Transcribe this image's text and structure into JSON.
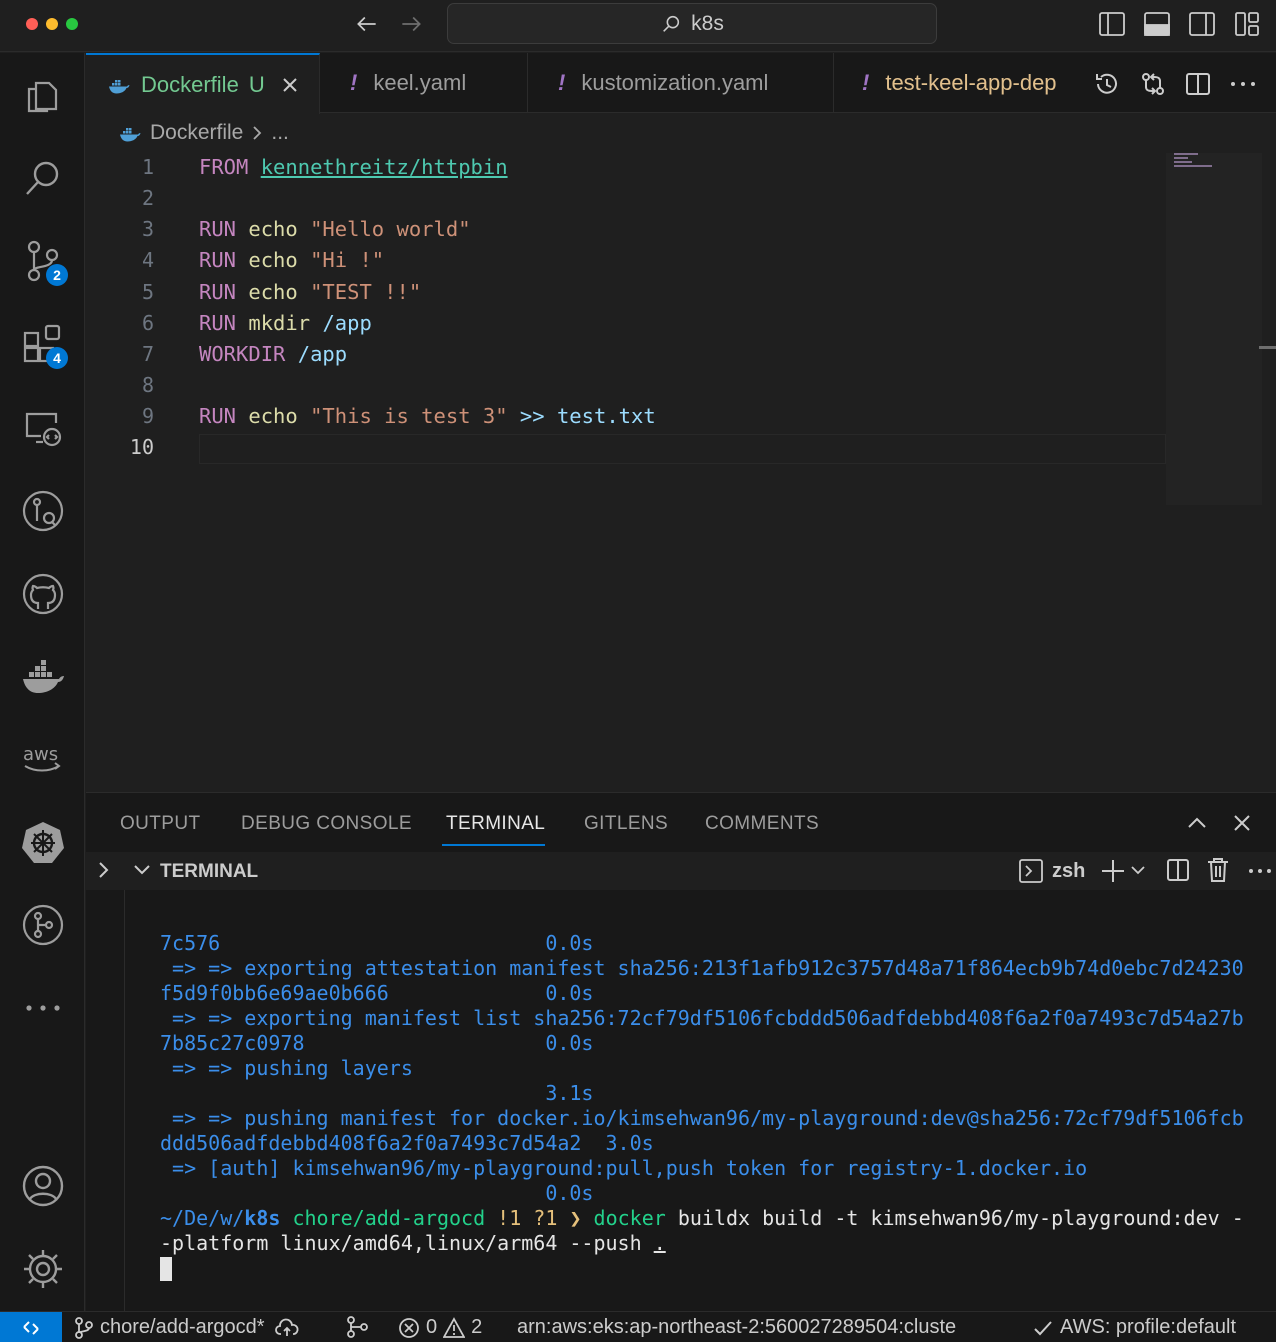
{
  "titlebar": {
    "search_text": "k8s"
  },
  "activity": {
    "scm_badge": "2",
    "extensions_badge": "4"
  },
  "tabs": [
    {
      "label": "Dockerfile",
      "status": "U"
    },
    {
      "label": "keel.yaml"
    },
    {
      "label": "kustomization.yaml"
    },
    {
      "label": "test-keel-app-dep"
    }
  ],
  "yaml_marker": "!",
  "breadcrumb": {
    "file": "Dockerfile",
    "more": "..."
  },
  "editor": {
    "line_numbers": [
      "1",
      "2",
      "3",
      "4",
      "5",
      "6",
      "7",
      "8",
      "9",
      "10"
    ],
    "lines": {
      "l1": {
        "kw": "FROM",
        "image": "kennethreitz/httpbin"
      },
      "l3": {
        "kw": "RUN",
        "cmd": "echo",
        "arg": "\"Hello world\""
      },
      "l4": {
        "kw": "RUN",
        "cmd": "echo",
        "arg": "\"Hi !\""
      },
      "l5": {
        "kw": "RUN",
        "cmd": "echo",
        "arg": "\"TEST !!\""
      },
      "l6": {
        "kw": "RUN",
        "cmd": "mkdir",
        "arg": "/app"
      },
      "l7": {
        "kw": "WORKDIR",
        "arg": "/app"
      },
      "l9": {
        "kw": "RUN",
        "cmd": "echo",
        "arg": "\"This is test 3\"",
        "op": ">>",
        "file": "test.txt"
      }
    }
  },
  "panel": {
    "tabs": [
      "OUTPUT",
      "DEBUG CONSOLE",
      "TERMINAL",
      "GITLENS",
      "COMMENTS"
    ],
    "active_tab": "TERMINAL",
    "section_title": "TERMINAL",
    "shell": "zsh"
  },
  "terminal": {
    "lines": [
      "7c576                           0.0s",
      " => => exporting attestation manifest sha256:213f1afb912c3757d48a71f864ecb9b74d0ebc7d24230",
      "f5d9f0bb6e69ae0b666             0.0s",
      " => => exporting manifest list sha256:72cf79df5106fcbddd506adfdebbd408f6a2f0a7493c7d54a27b",
      "7b85c27c0978                    0.0s",
      " => => pushing layers",
      "                                3.1s",
      " => => pushing manifest for docker.io/kimsehwan96/my-playground:dev@sha256:72cf79df5106fcb",
      "ddd506adfdebbd408f6a2f0a7493c7d54a2  3.0s",
      " => [auth] kimsehwan96/my-playground:pull,push token for registry-1.docker.io",
      "                                0.0s"
    ],
    "prompt": {
      "path_prefix": "~/De/w/",
      "dir": "k8s",
      "branch": "chore/add-argocd",
      "flags": "!1 ?1",
      "arrow": "❯",
      "command": "docker",
      "args": " buildx build -t kimsehwan96/my-playground:dev -",
      "continuation": "-platform linux/amd64,linux/arm64 --push ",
      "dot": "."
    }
  },
  "statusbar": {
    "branch": "chore/add-argocd*",
    "errors": "0",
    "warnings": "2",
    "k8s_context": "arn:aws:eks:ap-northeast-2:560027289504:cluste",
    "aws_profile": "AWS: profile:default"
  },
  "colors": {
    "accent": "#0078d4",
    "untracked": "#73c991",
    "modified": "#e2c08d",
    "terminal_blue": "#3b8eea"
  }
}
